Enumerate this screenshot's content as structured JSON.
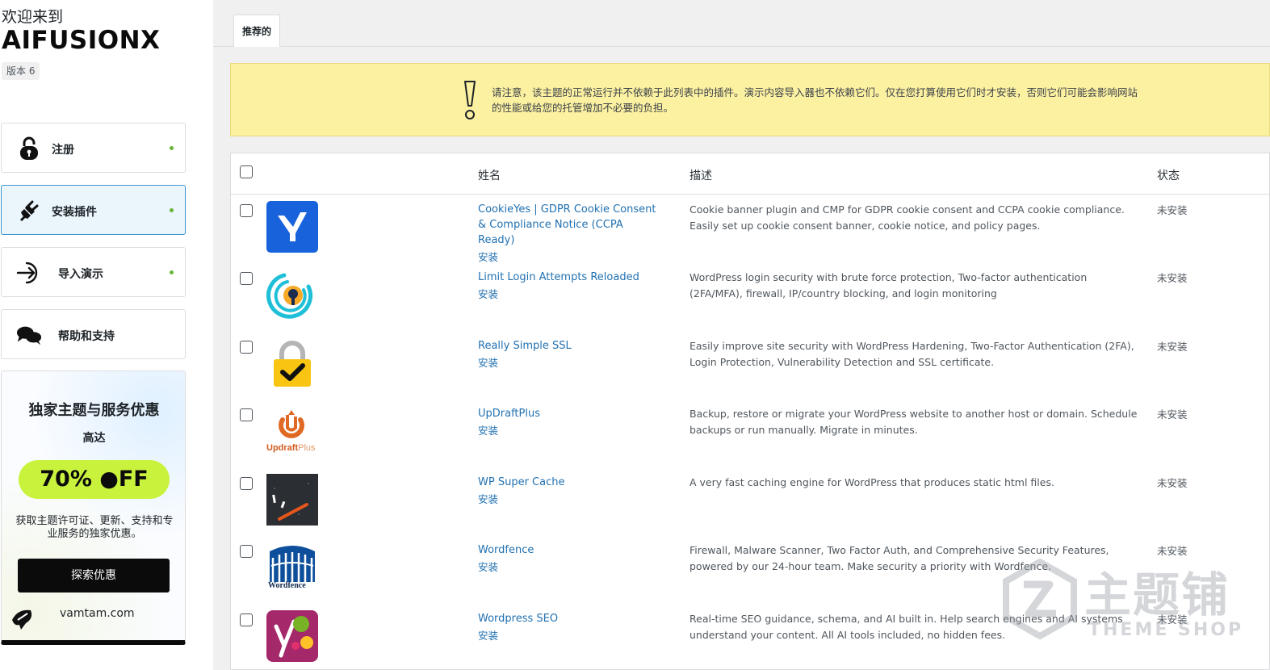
{
  "sidebar": {
    "welcome": "欢迎来到",
    "brand": "AIFUSIONX",
    "version": "版本 6",
    "items": [
      {
        "label": "注册",
        "icon": "lock-icon"
      },
      {
        "label": "安装插件",
        "icon": "plug-icon"
      },
      {
        "label": "导入演示",
        "icon": "import-arrow-icon"
      },
      {
        "label": "帮助和支持",
        "icon": "chat-bubbles-icon"
      }
    ],
    "promo": {
      "title": "独家主题与服务优惠",
      "subtitle": "高达",
      "discount": "70% ●FF",
      "description": "获取主题许可证、更新、支持和专业服务的独家优惠。",
      "button": "探索优惠",
      "site": "vamtam.com"
    }
  },
  "tabs": [
    {
      "label": "推荐的"
    }
  ],
  "notice": {
    "text": "请注意，该主题的正常运行并不依赖于此列表中的插件。演示内容导入器也不依赖它们。仅在您打算使用它们时才安装，否则它们可能会影响网站的性能或给您的托管增加不必要的负担。"
  },
  "table": {
    "headers": {
      "name": "姓名",
      "description": "描述",
      "status": "状态"
    },
    "install_label": "安装",
    "rows": [
      {
        "name": "CookieYes | GDPR Cookie Consent & Compliance Notice (CCPA Ready)",
        "description": "Cookie banner plugin and CMP for GDPR cookie consent and CCPA cookie compliance. Easily set up cookie consent banner, cookie notice, and policy pages.",
        "status": "未安装",
        "icon": "cookieyes-icon"
      },
      {
        "name": "Limit Login Attempts Reloaded",
        "description": "WordPress login security with brute force protection, Two-factor authentication (2FA/MFA), firewall, IP/country blocking, and login monitoring",
        "status": "未安装",
        "icon": "limit-login-icon"
      },
      {
        "name": "Really Simple SSL",
        "description": "Easily improve site security with WordPress Hardening, Two-Factor Authentication (2FA), Login Protection, Vulnerability Detection and SSL certificate.",
        "status": "未安装",
        "icon": "padlock-check-icon"
      },
      {
        "name": "UpDraftPlus",
        "description": "Backup, restore or migrate your WordPress website to another host or domain. Schedule backups or run manually. Migrate in minutes.",
        "status": "未安装",
        "icon": "updraftplus-icon",
        "icon_text": "UpdraftPlus"
      },
      {
        "name": "WP Super Cache",
        "description": "A very fast caching engine for WordPress that produces static html files.",
        "status": "未安装",
        "icon": "speedometer-icon"
      },
      {
        "name": "Wordfence",
        "description": "Firewall, Malware Scanner, Two Factor Auth, and Comprehensive Security Features, powered by our 24-hour team. Make security a priority with Wordfence.",
        "status": "未安装",
        "icon": "wordfence-icon",
        "icon_text": "Wordfence"
      },
      {
        "name": "Wordpress SEO",
        "description": "Real-time SEO guidance, schema, and AI built in. Help search engines and AI systems understand your content. All AI tools included, no hidden fees.",
        "status": "未安装",
        "icon": "yoast-icon"
      }
    ]
  },
  "watermark": {
    "zh": "主题铺",
    "en": "THEME SHOP"
  },
  "colors": {
    "link": "#2271b1",
    "notice_bg": "#fcf0a1",
    "active_nav": "#eaf5fc",
    "promo_pill": "#c9f23d",
    "dot": "#68b536"
  }
}
